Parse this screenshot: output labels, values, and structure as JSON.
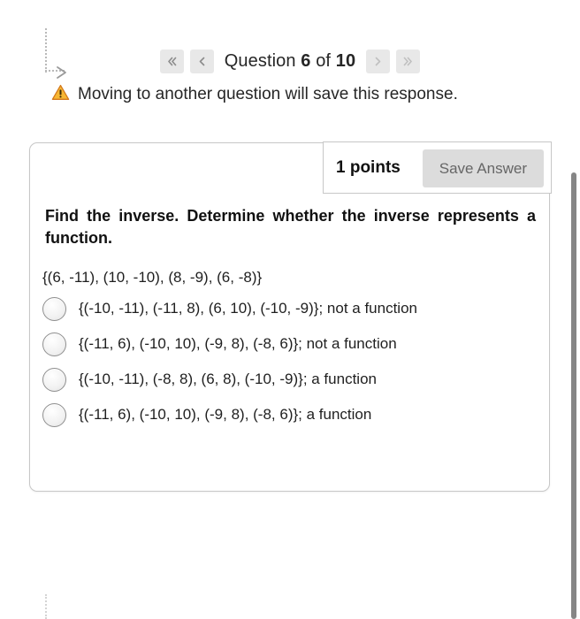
{
  "sidebar": {
    "expand_icon": "chevron-right-icon"
  },
  "nav": {
    "first_label": "«",
    "prev_label": "‹",
    "next_label": "›",
    "last_label": "»",
    "title_prefix": "Question",
    "current": "6",
    "title_middle": "of",
    "total": "10"
  },
  "warning": {
    "icon": "warning-triangle-icon",
    "text": "Moving to another question will save this response.",
    "icon_color": "#f5a623"
  },
  "question": {
    "points_label": "1 points",
    "save_label": "Save Answer",
    "prompt": "Find the inverse. Determine whether the inverse represents a function.",
    "relation": "{(6, -11), (10, -10), (8, -9), (6, -8)}",
    "options": [
      {
        "label": "{(-10, -11), (-11, 8), (6, 10), (-10, -9)}; not a function",
        "selected": false
      },
      {
        "label": "{(-11, 6), (-10, 10), (-9, 8), (-8, 6)}; not a function",
        "selected": false
      },
      {
        "label": "{(-10, -11), (-8, 8), (6, 8), (-10, -9)}; a function",
        "selected": false
      },
      {
        "label": "{(-11, 6), (-10, 10), (-9, 8), (-8, 6)}; a function",
        "selected": false
      }
    ]
  },
  "scrollbar": {
    "orientation": "vertical"
  }
}
